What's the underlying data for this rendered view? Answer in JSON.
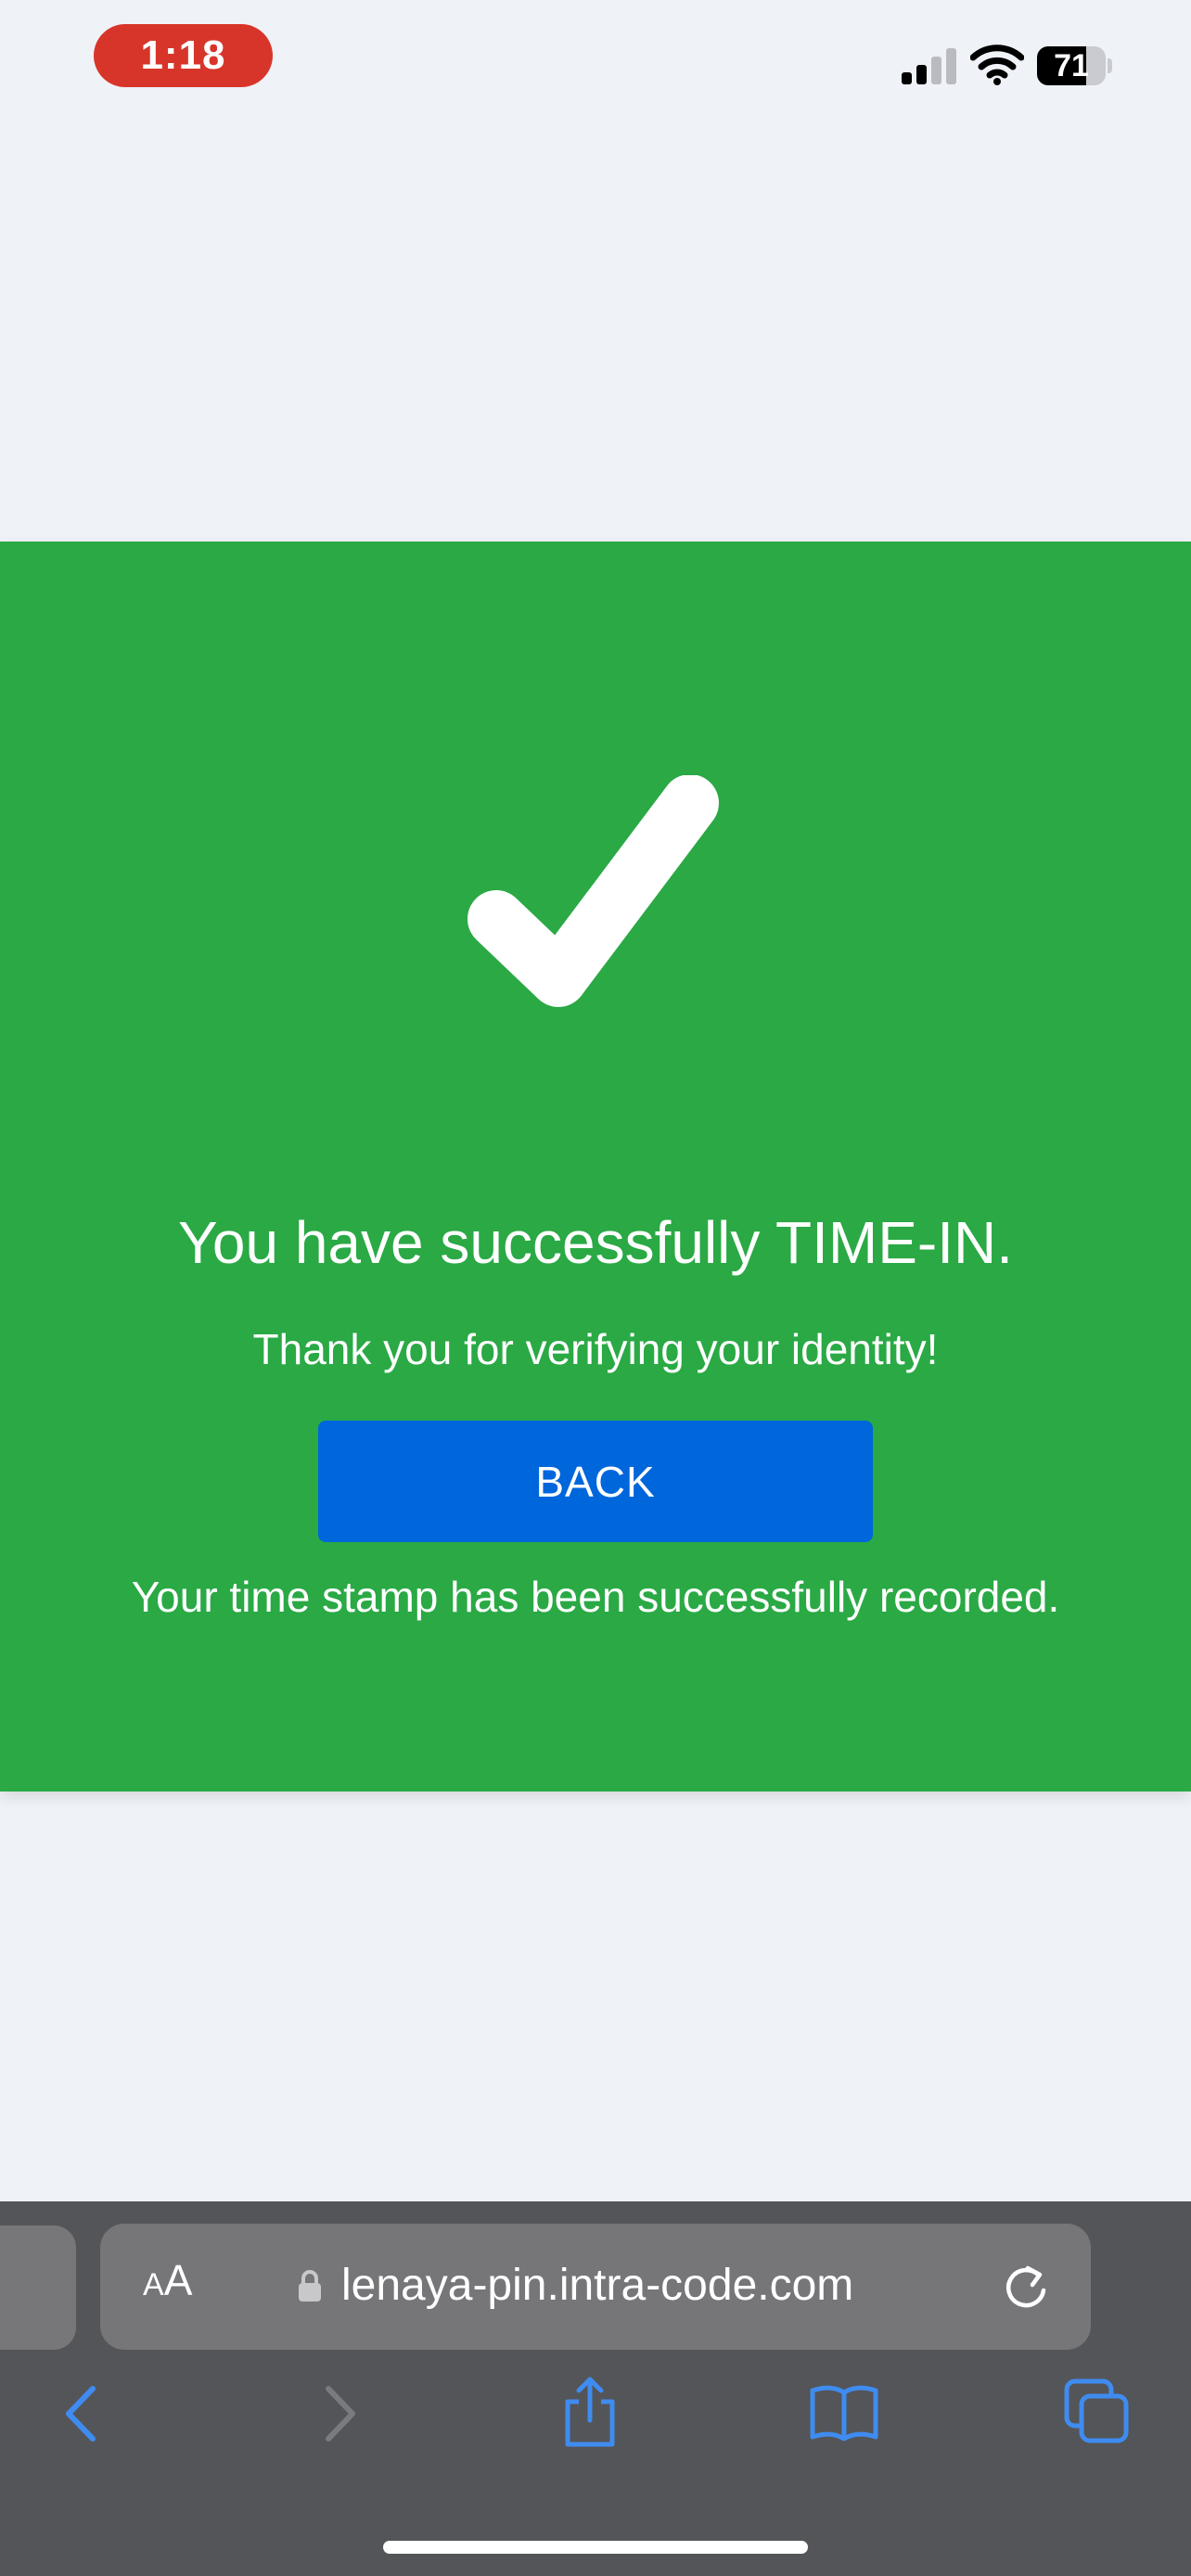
{
  "status_bar": {
    "time": "1:18",
    "battery_level": "71",
    "battery_fraction": 0.71,
    "icons": [
      "signal-icon",
      "wifi-icon",
      "battery-icon"
    ]
  },
  "success": {
    "icon": "checkmark-icon",
    "title": "You have successfully TIME-IN.",
    "subtitle": "Thank you for verifying your identity!",
    "back_label": "BACK",
    "note": "Your time stamp has been successfully recorded."
  },
  "browser": {
    "text_size_label_small": "A",
    "text_size_label_big": "A",
    "url": "lenaya-pin.intra-code.com",
    "toolbar": [
      "back-icon",
      "forward-icon",
      "share-icon",
      "bookmarks-icon",
      "tabs-icon"
    ]
  },
  "colors": {
    "success_green": "#2aa945",
    "button_blue": "#0066dc",
    "page_background": "#eff2f7",
    "browser_bar": "#545558",
    "accent_blue": "#3f8cf0",
    "time_pill": "#d8352a"
  }
}
